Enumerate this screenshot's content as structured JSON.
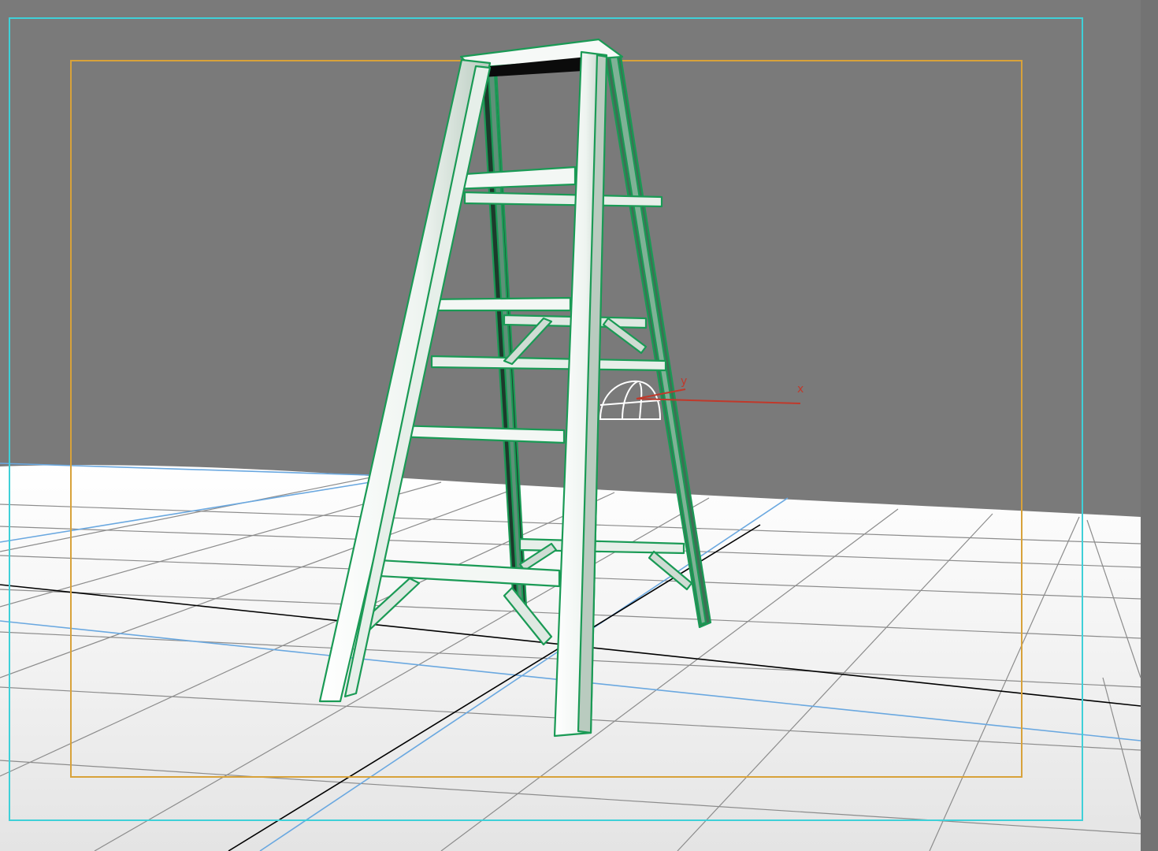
{
  "viewport": {
    "background_color": "#7a7a7a",
    "floor_color": "#f2f2f2",
    "grid_color": "#8a8a8a",
    "grid_major_color": "#000000",
    "grid_accent_color": "#6aa8e0",
    "safe_frame_outer_color": "#3fd0d8",
    "safe_frame_inner_color": "#d8a23a",
    "selection_color": "#1a9a55",
    "object_fill_color": "#f3f7f4",
    "object_shade_color": "#c9d8cf"
  },
  "gizmo": {
    "axis_x_label": "x",
    "axis_y_label": "y",
    "axis_color": "#c0392b",
    "icon": "light-bulb-dome-icon"
  },
  "objects": [
    {
      "name": "step-ladder",
      "selected": true
    }
  ]
}
